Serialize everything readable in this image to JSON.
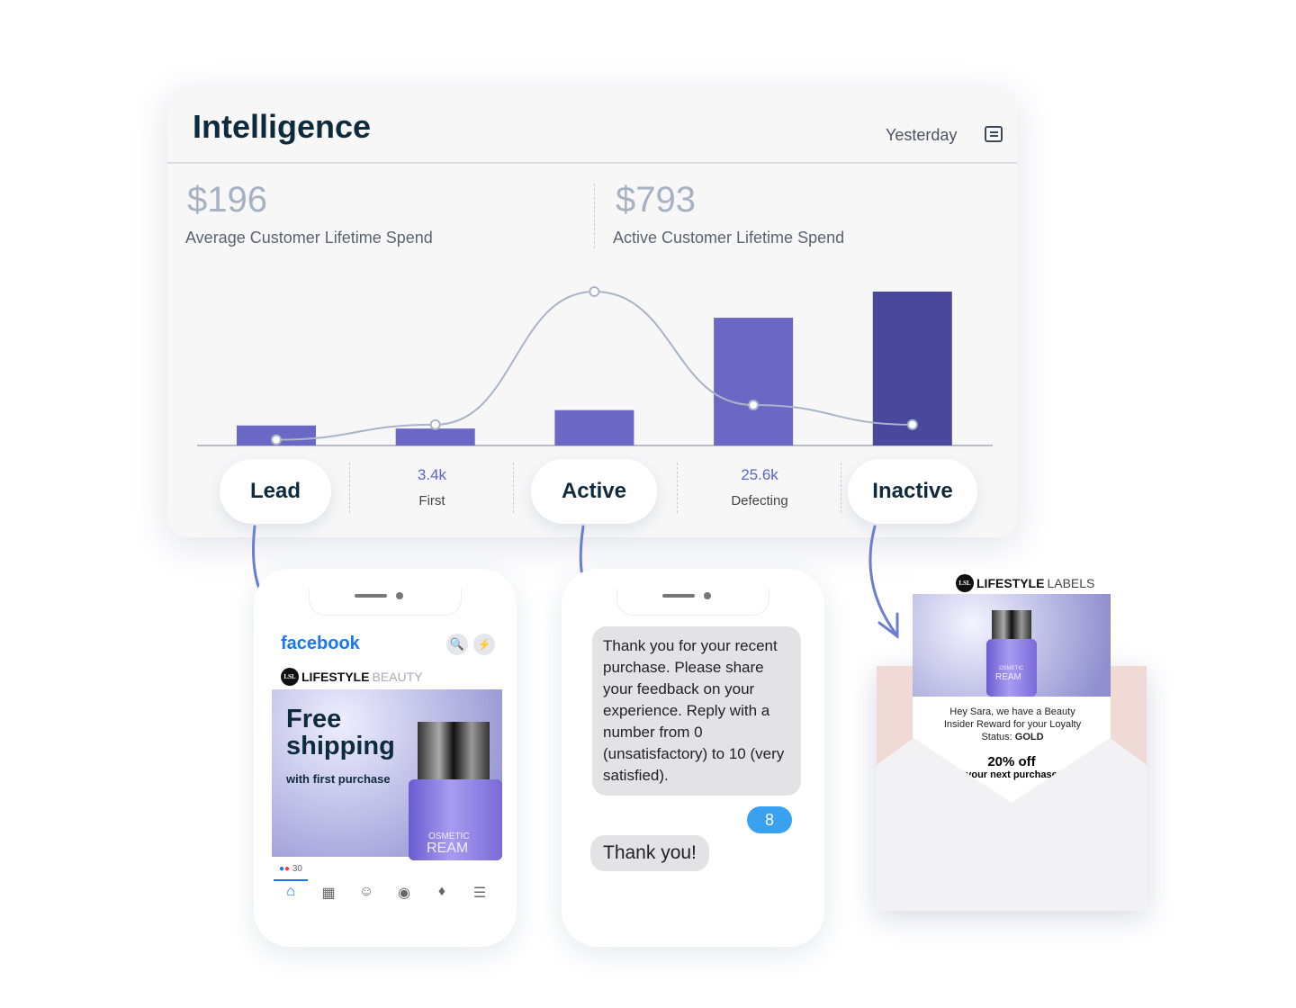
{
  "header": {
    "title": "Intelligence",
    "period": "Yesterday",
    "icon": "chat-icon"
  },
  "kpis": [
    {
      "value": "$196",
      "label": "Average Customer Lifetime Spend"
    },
    {
      "value": "$793",
      "label": "Active Customer Lifetime Spend"
    }
  ],
  "stages": {
    "lead": "Lead",
    "first": {
      "value": "3.4k",
      "label": "First"
    },
    "active": "Active",
    "defecting": {
      "value": "25.6k",
      "label": "Defecting"
    },
    "inactive": "Inactive"
  },
  "chart_data": {
    "type": "bar",
    "categories": [
      "Lead",
      "First",
      "Active",
      "Defecting",
      "Inactive"
    ],
    "series": [
      {
        "type": "bar",
        "values": [
          13,
          11,
          23,
          83,
          100
        ]
      },
      {
        "type": "line",
        "values": [
          2,
          12,
          100,
          25,
          12
        ]
      }
    ],
    "colors": {
      "bar": "#6b67c4",
      "bar_dark": "#4a489c",
      "line": "#a9b4c8"
    },
    "grid": false,
    "axes": false
  },
  "facebook": {
    "logo": "facebook",
    "brand_bold": "LIFESTYLE",
    "brand_light": "BEAUTY",
    "headline1": "Free",
    "headline2": "shipping",
    "sub": "with first purchase",
    "product1": "OSMETIC",
    "product2": "REAM",
    "reactions": "30",
    "brand_color": "#1877f2"
  },
  "sms": {
    "message": "Thank you for your recent purchase. Please share your feedback on your experience. Reply with a number from 0 (unsatisfactory) to 10 (very satisfied).",
    "reply": "8",
    "thanks": "Thank you!"
  },
  "email": {
    "brand_bold": "LIFESTYLE",
    "brand_light": "LABELS",
    "body": "Hey Sara, we have a Beauty Insider Reward for your Loyalty",
    "status_label": "Status:",
    "status": "GOLD",
    "offer": "20% off",
    "offer_sub": "your next purchase",
    "product1": "OSMETIC",
    "product2": "REAM"
  }
}
